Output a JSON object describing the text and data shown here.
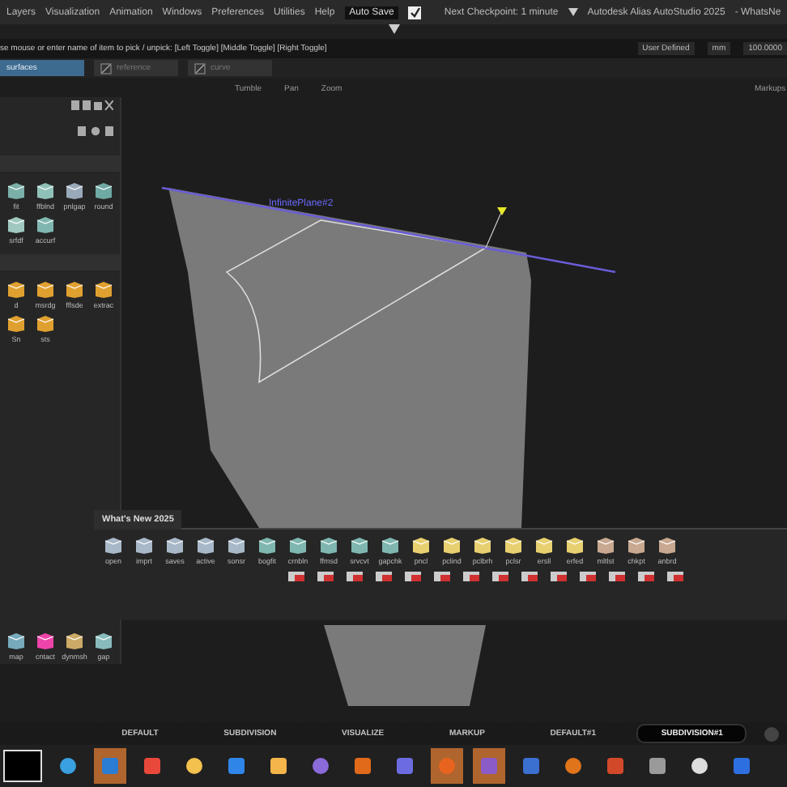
{
  "menu": {
    "items": [
      "Layers",
      "Visualization",
      "Animation",
      "Windows",
      "Preferences",
      "Utilities",
      "Help"
    ],
    "auto_save": {
      "label": "Auto Save",
      "checked": true
    },
    "checkpoint": "Next Checkpoint: 1 minute",
    "app_title": "Autodesk Alias AutoStudio 2025",
    "doc_title": "- WhatsNe"
  },
  "prompt": {
    "text": "se mouse or enter name of item to pick / unpick: [Left Toggle] [Middle Toggle] [Right Toggle]",
    "mode": "User Defined",
    "unit": "mm",
    "value": "100.0000"
  },
  "layers": [
    {
      "label": "surfaces",
      "selected": true
    },
    {
      "label": "reference",
      "selected": false
    },
    {
      "label": "curve",
      "selected": false
    }
  ],
  "viewport": {
    "nav": [
      "Tumble",
      "Pan",
      "Zoom"
    ],
    "markup": "Markups",
    "object_label": "InfinitePlane#2"
  },
  "palette": {
    "sections": [
      {
        "tools": [
          "fit",
          "ffblnd",
          "pnlgap",
          "round",
          "srfdf",
          "accurf"
        ]
      },
      {
        "tools": [
          "d",
          "msrdg",
          "fflsde",
          "extrac",
          "Sn",
          "sts"
        ]
      }
    ],
    "bottom_tools": [
      "map",
      "cntact",
      "dynmsh",
      "gap"
    ]
  },
  "shelf": {
    "tab": "What's New 2025",
    "tools": [
      "open",
      "imprt",
      "saves",
      "active",
      "sonsr",
      "bogfit",
      "crnbln",
      "ffmsd",
      "srvcvt",
      "gapchk",
      "pncl",
      "pclind",
      "pclbrh",
      "pclsr",
      "ersll",
      "erfed",
      "mltlst",
      "chkpt",
      "anbrd"
    ]
  },
  "workspaces": [
    {
      "label": "DEFAULT",
      "selected": false
    },
    {
      "label": "SUBDIVISION",
      "selected": false
    },
    {
      "label": "VISUALIZE",
      "selected": false
    },
    {
      "label": "MARKUP",
      "selected": false
    },
    {
      "label": "DEFAULT#1",
      "selected": false
    },
    {
      "label": "SUBDIVISION#1",
      "selected": true
    }
  ],
  "taskbar": [
    {
      "selected": false
    },
    {
      "selected": true
    },
    {
      "selected": false
    },
    {
      "selected": false
    },
    {
      "selected": false
    },
    {
      "selected": false
    },
    {
      "selected": false
    },
    {
      "selected": false
    },
    {
      "selected": false
    },
    {
      "selected": true
    },
    {
      "selected": true
    },
    {
      "selected": false
    },
    {
      "selected": false
    },
    {
      "selected": false
    },
    {
      "selected": false
    },
    {
      "selected": false
    },
    {
      "selected": false
    }
  ]
}
